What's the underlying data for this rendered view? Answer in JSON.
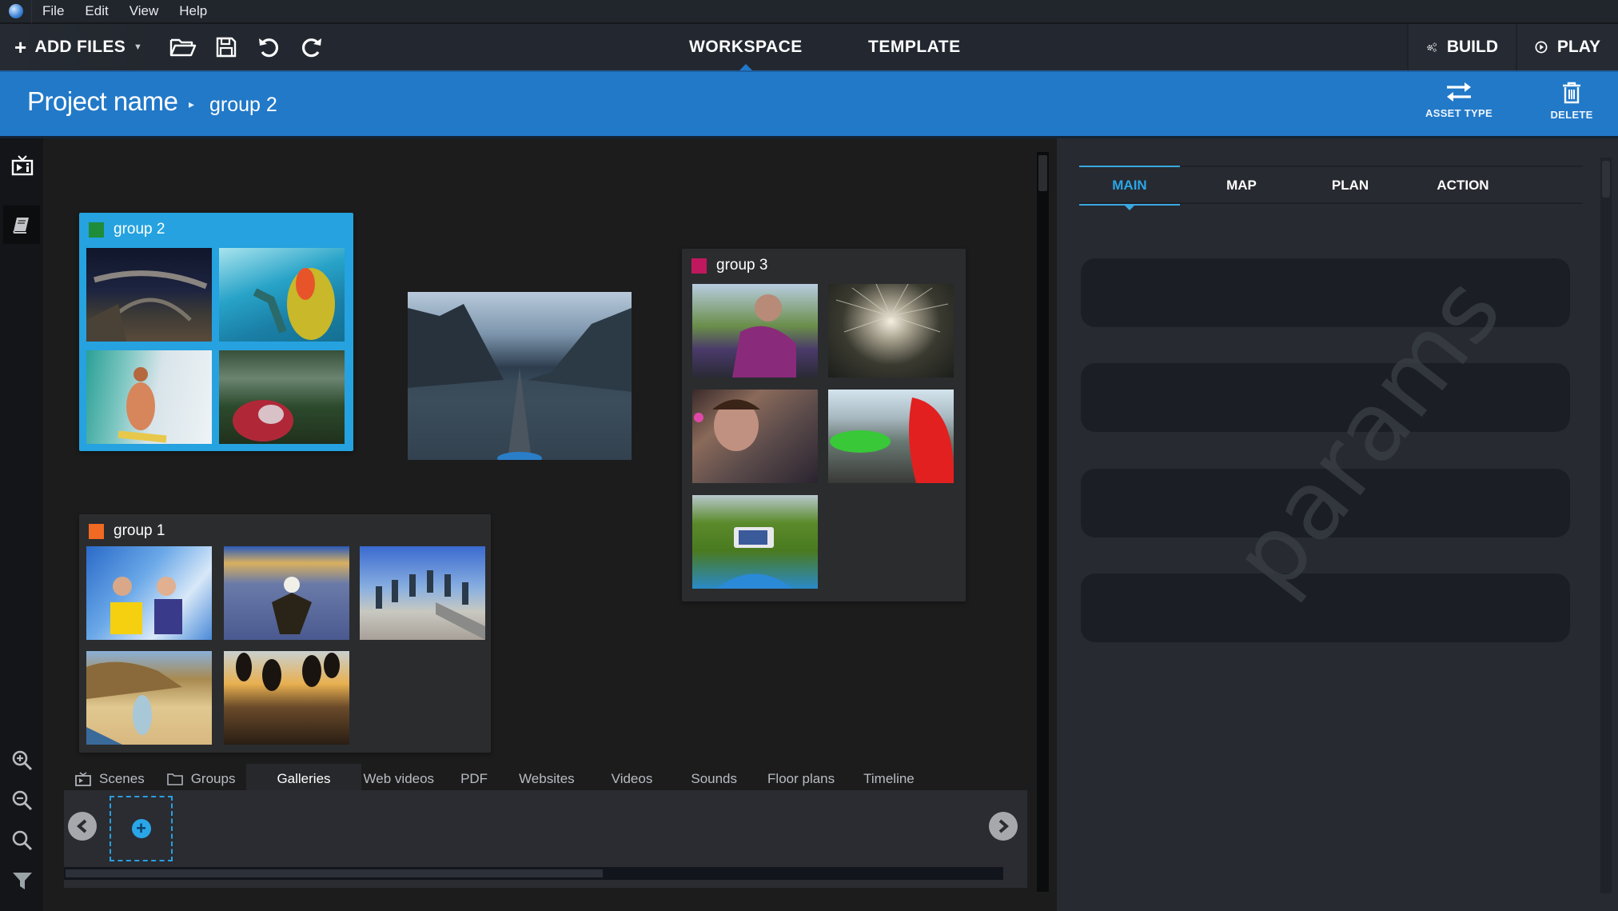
{
  "menubar": {
    "items": [
      "File",
      "Edit",
      "View",
      "Help"
    ]
  },
  "toolbar": {
    "add_files_label": "ADD FILES",
    "icons": [
      "folder-open-icon",
      "save-icon",
      "undo-icon",
      "redo-icon"
    ],
    "center_tabs": [
      {
        "label": "WORKSPACE",
        "active": true
      },
      {
        "label": "TEMPLATE",
        "active": false
      }
    ],
    "build_label": "BUILD",
    "play_label": "PLAY"
  },
  "breadcrumb": {
    "project": "Project name",
    "current": "group 2",
    "actions": [
      {
        "label": "ASSET TYPE",
        "icon": "swap-arrows-icon"
      },
      {
        "label": "DELETE",
        "icon": "trash-icon"
      }
    ]
  },
  "leftrail": {
    "top_icons": [
      "scenes-icon",
      "book-icon"
    ],
    "bottom_icons": [
      "zoom-in-icon",
      "zoom-out-icon",
      "search-icon",
      "filter-icon"
    ]
  },
  "canvas": {
    "groups": [
      {
        "name": "group 2",
        "color": "#1f8c3a",
        "selected": true,
        "thumbnails": [
          "bridge at night",
          "underwater snorkeler",
          "surfer in wave",
          "hammock in forest"
        ]
      },
      {
        "name": "group 3",
        "color": "#c0185e",
        "selected": false,
        "thumbnails": [
          "girl on bicycle",
          "steel wool sparks",
          "boy close-up",
          "drifting green car",
          "phone in hands on hill"
        ]
      },
      {
        "name": "group 1",
        "color": "#f06a23",
        "selected": false,
        "thumbnails": [
          "roller coaster riders",
          "skydiver above clouds",
          "skateboard jump sequence",
          "woman on beach",
          "backflip silhouettes at sunset"
        ]
      }
    ],
    "loose_asset": "kayak on mountain lake"
  },
  "bottom": {
    "tabs": [
      {
        "label": "Scenes",
        "icon": "scenes-icon",
        "active": false
      },
      {
        "label": "Groups",
        "icon": "folder-icon",
        "active": false
      },
      {
        "label": "Galleries",
        "active": true
      },
      {
        "label": "Web videos",
        "active": false
      },
      {
        "label": "PDF",
        "active": false
      },
      {
        "label": "Websites",
        "active": false
      },
      {
        "label": "Videos",
        "active": false
      },
      {
        "label": "Sounds",
        "active": false
      },
      {
        "label": "Floor plans",
        "active": false
      },
      {
        "label": "Timeline",
        "active": false
      }
    ],
    "add_slot_icon": "add-circle-icon"
  },
  "rightpanel": {
    "tabs": [
      {
        "label": "MAIN",
        "active": true
      },
      {
        "label": "MAP",
        "active": false
      },
      {
        "label": "PLAN",
        "active": false
      },
      {
        "label": "ACTION",
        "active": false
      }
    ],
    "watermark": "params",
    "slot_count": 4
  },
  "colors": {
    "accent_blue": "#2279c8",
    "selection_blue": "#25a2df",
    "active_tab_cyan": "#2aa6e8"
  }
}
